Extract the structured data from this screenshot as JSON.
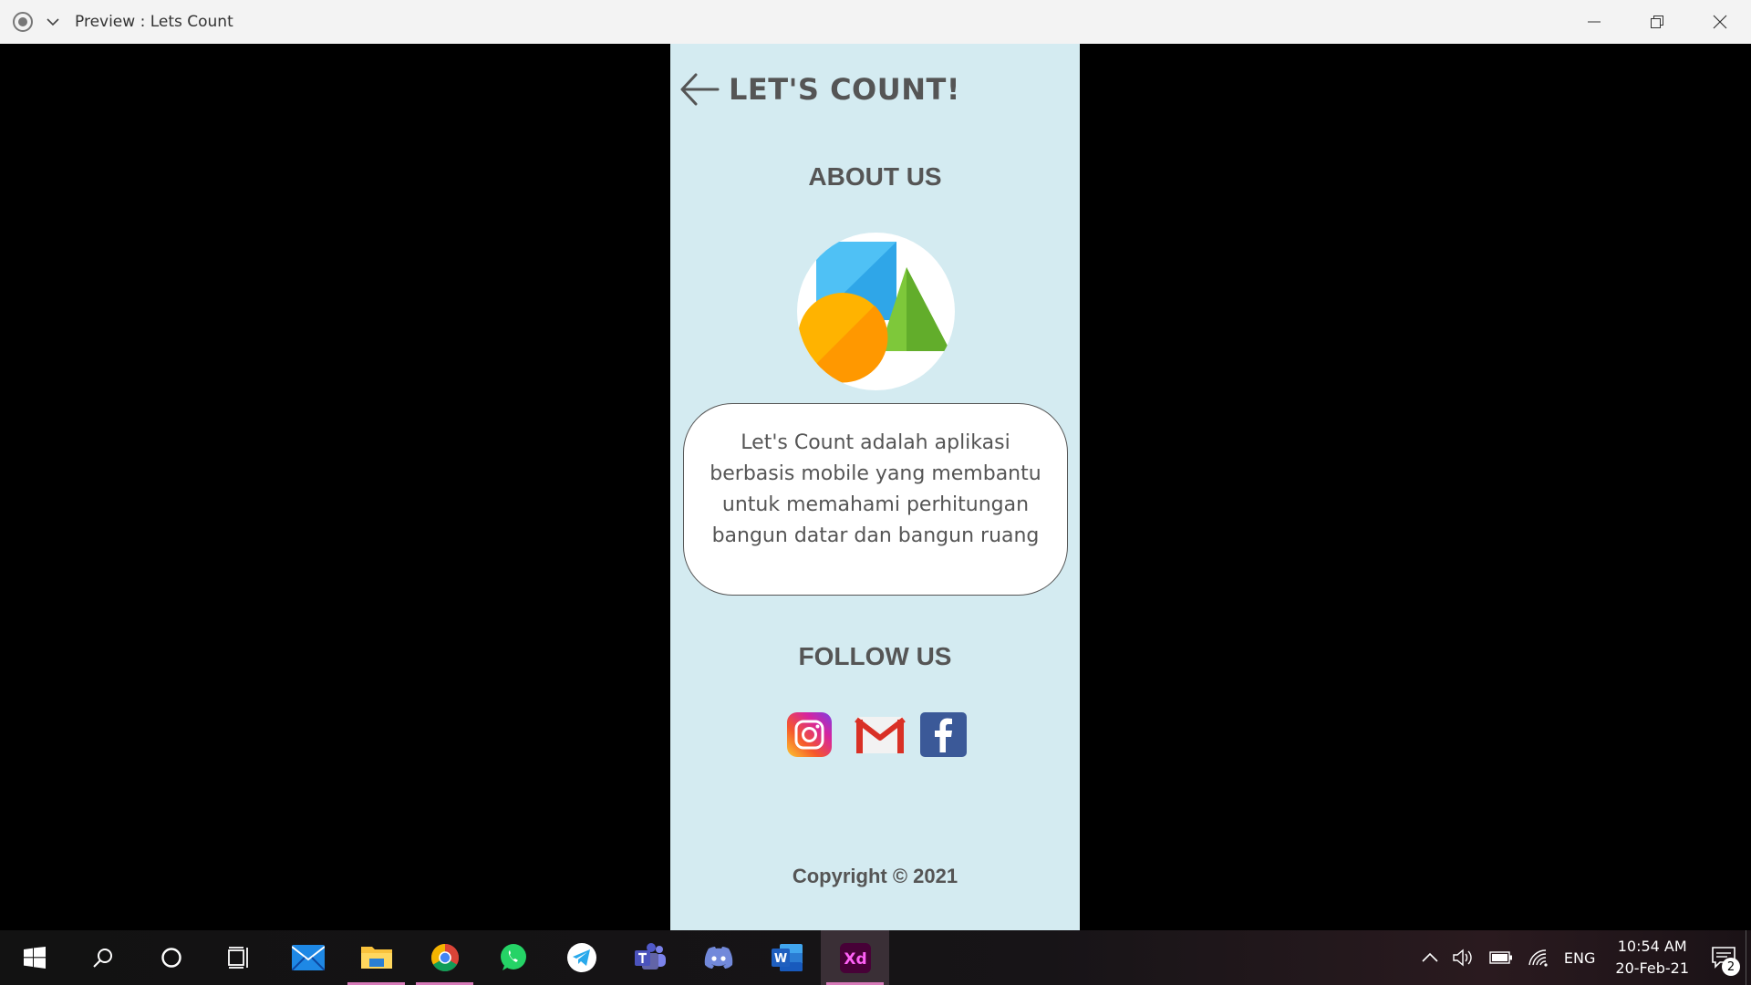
{
  "window": {
    "title": "Preview : Lets Count"
  },
  "app": {
    "title": "LET'S COUNT!",
    "about_heading": "ABOUT US",
    "about_text": "Let's Count adalah aplikasi berbasis mobile yang membantu untuk memahami perhitungan bangun datar dan bangun ruang",
    "follow_heading": "FOLLOW US",
    "socials": [
      "instagram-icon",
      "gmail-icon",
      "facebook-icon"
    ],
    "copyright": "Copyright © 2021",
    "colors": {
      "background": "#d4ebf1",
      "text": "#555555",
      "card": "#ffffff"
    }
  },
  "taskbar": {
    "apps": [
      "windows-start-icon",
      "search-icon",
      "cortana-icon",
      "task-view-icon",
      "mail-icon",
      "file-explorer-icon",
      "chrome-icon",
      "whatsapp-icon",
      "telegram-icon",
      "teams-icon",
      "discord-icon",
      "word-icon",
      "adobe-xd-icon"
    ],
    "xd_label": "Xd",
    "word_label": "W",
    "language": "ENG",
    "time": "10:54 AM",
    "date": "20-Feb-21",
    "notification_count": "2"
  }
}
